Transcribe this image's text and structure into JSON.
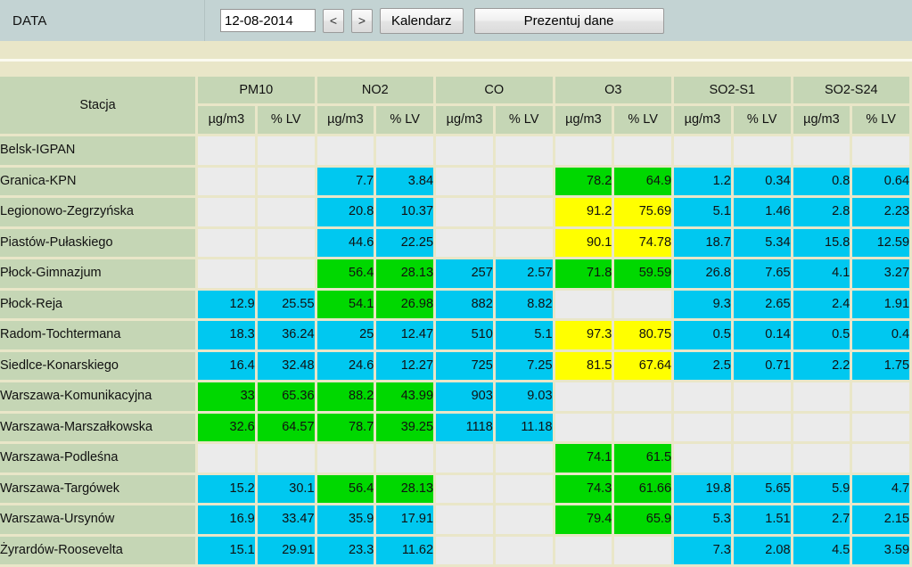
{
  "toolbar": {
    "label": "DATA",
    "date_value": "12-08-2014",
    "date_placeholder": "dd-mm-rrrr",
    "prev_label": "<",
    "next_label": ">",
    "calendar_label": "Kalendarz",
    "present_label": "Prezentuj dane"
  },
  "table": {
    "station_header": "Stacja",
    "unit_conc": "µg/m3",
    "unit_pct": "% LV",
    "pollutants": [
      "PM10",
      "NO2",
      "CO",
      "O3",
      "SO2-S1",
      "SO2-S24"
    ],
    "colors": {
      "empty": "#ebebeb",
      "cyan": "#00c8f0",
      "green": "#00d800",
      "yellow": "#ffff00",
      "header": "#c5d6b5",
      "grid": "#e9e6c8",
      "toolbar": "#c3d3d3"
    },
    "rows": [
      {
        "station": "Belsk-IGPAN",
        "cells": [
          {
            "v": "",
            "s": "empty"
          },
          {
            "v": "",
            "s": "empty"
          },
          {
            "v": "",
            "s": "empty"
          },
          {
            "v": "",
            "s": "empty"
          },
          {
            "v": "",
            "s": "empty"
          },
          {
            "v": "",
            "s": "empty"
          },
          {
            "v": "",
            "s": "empty"
          },
          {
            "v": "",
            "s": "empty"
          },
          {
            "v": "",
            "s": "empty"
          },
          {
            "v": "",
            "s": "empty"
          },
          {
            "v": "",
            "s": "empty"
          },
          {
            "v": "",
            "s": "empty"
          }
        ]
      },
      {
        "station": "Granica-KPN",
        "cells": [
          {
            "v": "",
            "s": "empty"
          },
          {
            "v": "",
            "s": "empty"
          },
          {
            "v": "7.7",
            "s": "cyan"
          },
          {
            "v": "3.84",
            "s": "cyan"
          },
          {
            "v": "",
            "s": "empty"
          },
          {
            "v": "",
            "s": "empty"
          },
          {
            "v": "78.2",
            "s": "green"
          },
          {
            "v": "64.9",
            "s": "green"
          },
          {
            "v": "1.2",
            "s": "cyan"
          },
          {
            "v": "0.34",
            "s": "cyan"
          },
          {
            "v": "0.8",
            "s": "cyan"
          },
          {
            "v": "0.64",
            "s": "cyan"
          }
        ]
      },
      {
        "station": "Legionowo-Zegrzyńska",
        "cells": [
          {
            "v": "",
            "s": "empty"
          },
          {
            "v": "",
            "s": "empty"
          },
          {
            "v": "20.8",
            "s": "cyan"
          },
          {
            "v": "10.37",
            "s": "cyan"
          },
          {
            "v": "",
            "s": "empty"
          },
          {
            "v": "",
            "s": "empty"
          },
          {
            "v": "91.2",
            "s": "yellow"
          },
          {
            "v": "75.69",
            "s": "yellow"
          },
          {
            "v": "5.1",
            "s": "cyan"
          },
          {
            "v": "1.46",
            "s": "cyan"
          },
          {
            "v": "2.8",
            "s": "cyan"
          },
          {
            "v": "2.23",
            "s": "cyan"
          }
        ]
      },
      {
        "station": "Piastów-Pułaskiego",
        "cells": [
          {
            "v": "",
            "s": "empty"
          },
          {
            "v": "",
            "s": "empty"
          },
          {
            "v": "44.6",
            "s": "cyan"
          },
          {
            "v": "22.25",
            "s": "cyan"
          },
          {
            "v": "",
            "s": "empty"
          },
          {
            "v": "",
            "s": "empty"
          },
          {
            "v": "90.1",
            "s": "yellow"
          },
          {
            "v": "74.78",
            "s": "yellow"
          },
          {
            "v": "18.7",
            "s": "cyan"
          },
          {
            "v": "5.34",
            "s": "cyan"
          },
          {
            "v": "15.8",
            "s": "cyan"
          },
          {
            "v": "12.59",
            "s": "cyan"
          }
        ]
      },
      {
        "station": "Płock-Gimnazjum",
        "cells": [
          {
            "v": "",
            "s": "empty"
          },
          {
            "v": "",
            "s": "empty"
          },
          {
            "v": "56.4",
            "s": "green"
          },
          {
            "v": "28.13",
            "s": "green"
          },
          {
            "v": "257",
            "s": "cyan"
          },
          {
            "v": "2.57",
            "s": "cyan"
          },
          {
            "v": "71.8",
            "s": "green"
          },
          {
            "v": "59.59",
            "s": "green"
          },
          {
            "v": "26.8",
            "s": "cyan"
          },
          {
            "v": "7.65",
            "s": "cyan"
          },
          {
            "v": "4.1",
            "s": "cyan"
          },
          {
            "v": "3.27",
            "s": "cyan"
          }
        ]
      },
      {
        "station": "Płock-Reja",
        "cells": [
          {
            "v": "12.9",
            "s": "cyan"
          },
          {
            "v": "25.55",
            "s": "cyan"
          },
          {
            "v": "54.1",
            "s": "green"
          },
          {
            "v": "26.98",
            "s": "green"
          },
          {
            "v": "882",
            "s": "cyan"
          },
          {
            "v": "8.82",
            "s": "cyan"
          },
          {
            "v": "",
            "s": "empty"
          },
          {
            "v": "",
            "s": "empty"
          },
          {
            "v": "9.3",
            "s": "cyan"
          },
          {
            "v": "2.65",
            "s": "cyan"
          },
          {
            "v": "2.4",
            "s": "cyan"
          },
          {
            "v": "1.91",
            "s": "cyan"
          }
        ]
      },
      {
        "station": "Radom-Tochtermana",
        "cells": [
          {
            "v": "18.3",
            "s": "cyan"
          },
          {
            "v": "36.24",
            "s": "cyan"
          },
          {
            "v": "25",
            "s": "cyan"
          },
          {
            "v": "12.47",
            "s": "cyan"
          },
          {
            "v": "510",
            "s": "cyan"
          },
          {
            "v": "5.1",
            "s": "cyan"
          },
          {
            "v": "97.3",
            "s": "yellow"
          },
          {
            "v": "80.75",
            "s": "yellow"
          },
          {
            "v": "0.5",
            "s": "cyan"
          },
          {
            "v": "0.14",
            "s": "cyan"
          },
          {
            "v": "0.5",
            "s": "cyan"
          },
          {
            "v": "0.4",
            "s": "cyan"
          }
        ]
      },
      {
        "station": "Siedlce-Konarskiego",
        "cells": [
          {
            "v": "16.4",
            "s": "cyan"
          },
          {
            "v": "32.48",
            "s": "cyan"
          },
          {
            "v": "24.6",
            "s": "cyan"
          },
          {
            "v": "12.27",
            "s": "cyan"
          },
          {
            "v": "725",
            "s": "cyan"
          },
          {
            "v": "7.25",
            "s": "cyan"
          },
          {
            "v": "81.5",
            "s": "yellow"
          },
          {
            "v": "67.64",
            "s": "yellow"
          },
          {
            "v": "2.5",
            "s": "cyan"
          },
          {
            "v": "0.71",
            "s": "cyan"
          },
          {
            "v": "2.2",
            "s": "cyan"
          },
          {
            "v": "1.75",
            "s": "cyan"
          }
        ]
      },
      {
        "station": "Warszawa-Komunikacyjna",
        "cells": [
          {
            "v": "33",
            "s": "green"
          },
          {
            "v": "65.36",
            "s": "green"
          },
          {
            "v": "88.2",
            "s": "green"
          },
          {
            "v": "43.99",
            "s": "green"
          },
          {
            "v": "903",
            "s": "cyan"
          },
          {
            "v": "9.03",
            "s": "cyan"
          },
          {
            "v": "",
            "s": "empty"
          },
          {
            "v": "",
            "s": "empty"
          },
          {
            "v": "",
            "s": "empty"
          },
          {
            "v": "",
            "s": "empty"
          },
          {
            "v": "",
            "s": "empty"
          },
          {
            "v": "",
            "s": "empty"
          }
        ]
      },
      {
        "station": "Warszawa-Marszałkowska",
        "cells": [
          {
            "v": "32.6",
            "s": "green"
          },
          {
            "v": "64.57",
            "s": "green"
          },
          {
            "v": "78.7",
            "s": "green"
          },
          {
            "v": "39.25",
            "s": "green"
          },
          {
            "v": "1118",
            "s": "cyan"
          },
          {
            "v": "11.18",
            "s": "cyan"
          },
          {
            "v": "",
            "s": "empty"
          },
          {
            "v": "",
            "s": "empty"
          },
          {
            "v": "",
            "s": "empty"
          },
          {
            "v": "",
            "s": "empty"
          },
          {
            "v": "",
            "s": "empty"
          },
          {
            "v": "",
            "s": "empty"
          }
        ]
      },
      {
        "station": "Warszawa-Podleśna",
        "cells": [
          {
            "v": "",
            "s": "empty"
          },
          {
            "v": "",
            "s": "empty"
          },
          {
            "v": "",
            "s": "empty"
          },
          {
            "v": "",
            "s": "empty"
          },
          {
            "v": "",
            "s": "empty"
          },
          {
            "v": "",
            "s": "empty"
          },
          {
            "v": "74.1",
            "s": "green"
          },
          {
            "v": "61.5",
            "s": "green"
          },
          {
            "v": "",
            "s": "empty"
          },
          {
            "v": "",
            "s": "empty"
          },
          {
            "v": "",
            "s": "empty"
          },
          {
            "v": "",
            "s": "empty"
          }
        ]
      },
      {
        "station": "Warszawa-Targówek",
        "cells": [
          {
            "v": "15.2",
            "s": "cyan"
          },
          {
            "v": "30.1",
            "s": "cyan"
          },
          {
            "v": "56.4",
            "s": "green"
          },
          {
            "v": "28.13",
            "s": "green"
          },
          {
            "v": "",
            "s": "empty"
          },
          {
            "v": "",
            "s": "empty"
          },
          {
            "v": "74.3",
            "s": "green"
          },
          {
            "v": "61.66",
            "s": "green"
          },
          {
            "v": "19.8",
            "s": "cyan"
          },
          {
            "v": "5.65",
            "s": "cyan"
          },
          {
            "v": "5.9",
            "s": "cyan"
          },
          {
            "v": "4.7",
            "s": "cyan"
          }
        ]
      },
      {
        "station": "Warszawa-Ursynów",
        "cells": [
          {
            "v": "16.9",
            "s": "cyan"
          },
          {
            "v": "33.47",
            "s": "cyan"
          },
          {
            "v": "35.9",
            "s": "cyan"
          },
          {
            "v": "17.91",
            "s": "cyan"
          },
          {
            "v": "",
            "s": "empty"
          },
          {
            "v": "",
            "s": "empty"
          },
          {
            "v": "79.4",
            "s": "green"
          },
          {
            "v": "65.9",
            "s": "green"
          },
          {
            "v": "5.3",
            "s": "cyan"
          },
          {
            "v": "1.51",
            "s": "cyan"
          },
          {
            "v": "2.7",
            "s": "cyan"
          },
          {
            "v": "2.15",
            "s": "cyan"
          }
        ]
      },
      {
        "station": "Żyrardów-Roosevelta",
        "cells": [
          {
            "v": "15.1",
            "s": "cyan"
          },
          {
            "v": "29.91",
            "s": "cyan"
          },
          {
            "v": "23.3",
            "s": "cyan"
          },
          {
            "v": "11.62",
            "s": "cyan"
          },
          {
            "v": "",
            "s": "empty"
          },
          {
            "v": "",
            "s": "empty"
          },
          {
            "v": "",
            "s": "empty"
          },
          {
            "v": "",
            "s": "empty"
          },
          {
            "v": "7.3",
            "s": "cyan"
          },
          {
            "v": "2.08",
            "s": "cyan"
          },
          {
            "v": "4.5",
            "s": "cyan"
          },
          {
            "v": "3.59",
            "s": "cyan"
          }
        ]
      }
    ]
  }
}
